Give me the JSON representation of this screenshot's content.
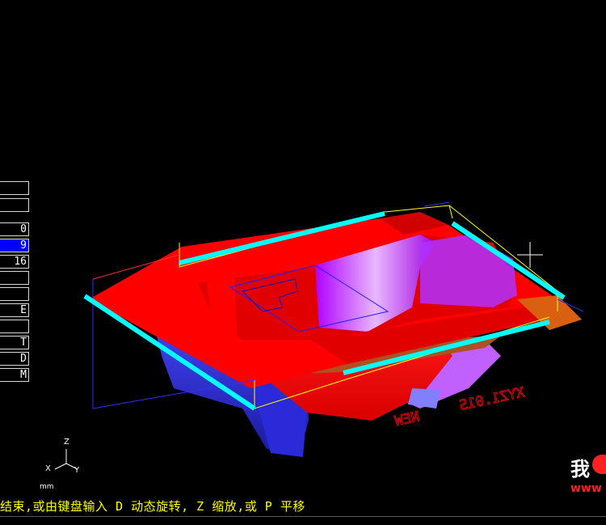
{
  "side_menu": {
    "items": [
      {
        "label": ""
      },
      {
        "label": ""
      },
      {
        "label": "0"
      },
      {
        "label": "9",
        "active": true
      },
      {
        "label": "16"
      },
      {
        "label": ""
      },
      {
        "label": ""
      },
      {
        "label": "E"
      },
      {
        "label": ""
      },
      {
        "label": "T"
      },
      {
        "label": "D"
      },
      {
        "label": "M"
      }
    ]
  },
  "model": {
    "engraving": "XYZ1.01S",
    "engraving2": "NEW"
  },
  "triad": {
    "z": "Z",
    "x": "X",
    "y": "Y",
    "units": "mm"
  },
  "status": {
    "prompt": "结束,或由键盘输入 D 动态旋转, Z 缩放,或 P 平移"
  },
  "watermark": {
    "text": "我",
    "url": "www"
  },
  "colors": {
    "background": "#000000",
    "part_red": "#ff0000",
    "part_blue": "#3030ff",
    "part_violet": "#c000ff",
    "edge_cyan": "#00ffff",
    "wire_yellow": "#ffff00",
    "prompt_yellow": "#ffff00",
    "menu_active": "#0000ff"
  }
}
